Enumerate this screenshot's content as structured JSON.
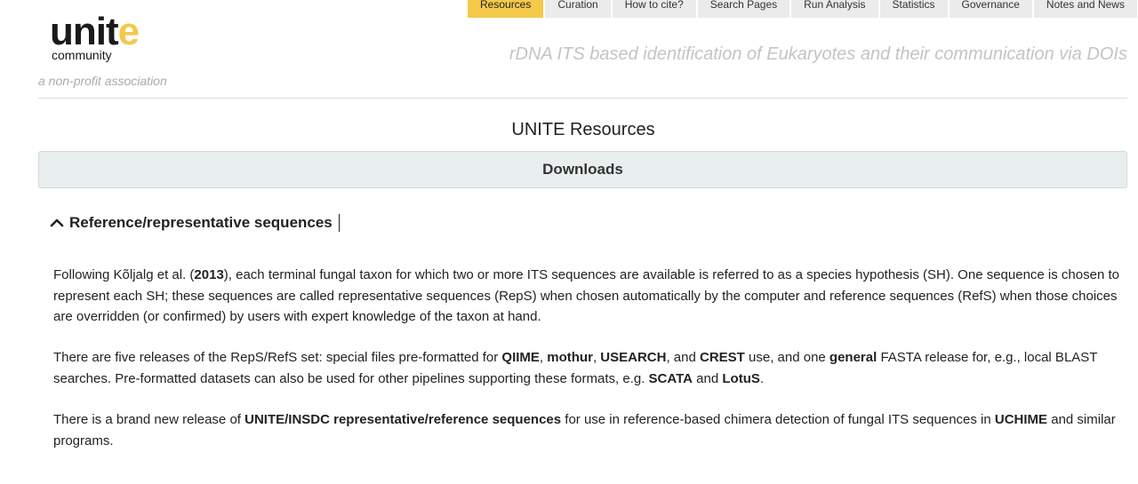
{
  "nav": {
    "tabs": [
      {
        "label": "Resources",
        "active": true
      },
      {
        "label": "Curation",
        "active": false
      },
      {
        "label": "How to cite?",
        "active": false
      },
      {
        "label": "Search Pages",
        "active": false
      },
      {
        "label": "Run Analysis",
        "active": false
      },
      {
        "label": "Statistics",
        "active": false
      },
      {
        "label": "Governance",
        "active": false
      },
      {
        "label": "Notes and News",
        "active": false
      }
    ]
  },
  "header": {
    "logo_main": "unit",
    "logo_accent": "e",
    "logo_sub": "community",
    "tagline_small": "a non-profit association",
    "tagline_big": "rDNA ITS based identification of Eukaryotes and their communication via DOIs"
  },
  "main": {
    "title": "UNITE Resources",
    "downloads_label": "Downloads",
    "section_title": "Reference/representative sequences",
    "p1": {
      "t1": "Following Kõljalg et al. (",
      "b1": "2013",
      "t2": "), each terminal fungal taxon for which two or more ITS sequences are available is referred to as a species hypothesis (SH). One sequence is chosen to represent each SH; these sequences are called representative sequences (RepS) when chosen automatically by the computer and reference sequences (RefS) when those choices are overridden (or confirmed) by users with expert knowledge of the taxon at hand."
    },
    "p2": {
      "t1": "There are five releases of the RepS/RefS set: special files pre-formatted for ",
      "b1": "QIIME",
      "t2": ", ",
      "b2": "mothur",
      "t3": ", ",
      "b3": "USEARCH",
      "t4": ", and ",
      "b4": "CREST",
      "t5": " use, and one ",
      "b5": "general",
      "t6": " FASTA release for, e.g., local BLAST searches. Pre-formatted datasets can also be used for other pipelines supporting these formats, e.g. ",
      "b6": "SCATA",
      "t7": " and ",
      "b7": "LotuS",
      "t8": "."
    },
    "p3": {
      "t1": "There is a brand new release of ",
      "b1": "UNITE/INSDC representative/reference sequences",
      "t2": " for use in reference-based chimera detection of fungal ITS sequences in ",
      "b2": "UCHIME",
      "t3": " and similar programs."
    }
  }
}
